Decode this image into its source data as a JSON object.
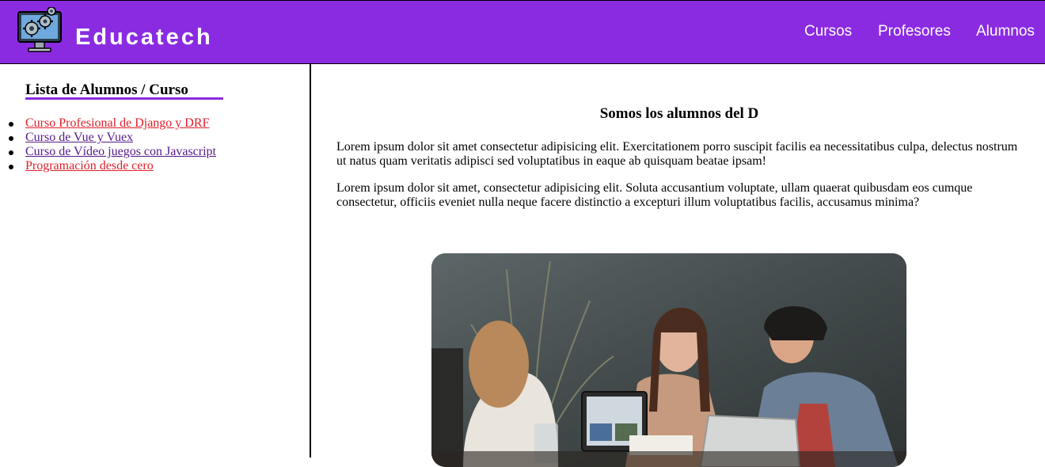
{
  "navbar": {
    "brand": "Educatech",
    "links": [
      "Cursos",
      "Profesores",
      "Alumnos"
    ],
    "color": "#8a2be2"
  },
  "sidebar": {
    "title": "Lista de Alumnos / Curso",
    "courses": [
      {
        "label": "Curso Profesional de Django y DRF",
        "state": "unvisited"
      },
      {
        "label": "Curso de Vue y Vuex",
        "state": "visited"
      },
      {
        "label": "Curso de Vídeo juegos con Javascript",
        "state": "visited"
      },
      {
        "label": "Programación desde cero",
        "state": "unvisited"
      }
    ]
  },
  "main": {
    "heading": "Somos los alumnos del D",
    "paragraphs": [
      "Lorem ipsum dolor sit amet consectetur adipisicing elit. Exercitationem porro suscipit facilis ea necessitatibus culpa, delectus nostrum ut natus quam veritatis adipisci sed voluptatibus in eaque ab quisquam beatae ipsam!",
      "Lorem ipsum dolor sit amet, consectetur adipisicing elit. Soluta accusantium voluptate, ullam quaerat quibusdam eos cumque consectetur, officiis eveniet nulla neque facere distinctio a excepturi illum voluptatibus facilis, accusamus minima?"
    ],
    "image_icon": "students-photo"
  },
  "colors": {
    "accent": "#8a2be2",
    "link_unvisited": "#e0202b",
    "link_visited": "#551a8b"
  }
}
